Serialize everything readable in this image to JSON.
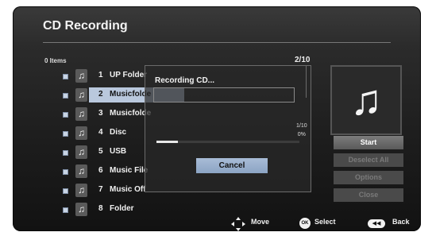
{
  "header": {
    "title": "CD Recording",
    "items_count": "0 Items",
    "page": "2/10"
  },
  "tracks": [
    {
      "num": "1",
      "name": "UP Folder",
      "selected": false
    },
    {
      "num": "2",
      "name": "Musicfolde",
      "selected": true
    },
    {
      "num": "3",
      "name": "Musicfolde",
      "selected": false
    },
    {
      "num": "4",
      "name": "Disc",
      "selected": false
    },
    {
      "num": "5",
      "name": "USB",
      "selected": false
    },
    {
      "num": "6",
      "name": "Music File",
      "selected": false
    },
    {
      "num": "7",
      "name": "Music Off",
      "selected": false
    },
    {
      "num": "8",
      "name": "Folder",
      "selected": false
    }
  ],
  "icons": {
    "track": "music-note-icon",
    "album_art": "music-note-icon"
  },
  "actions": [
    {
      "label": "Start",
      "enabled": true
    },
    {
      "label": "Deselect All",
      "enabled": false
    },
    {
      "label": "Options",
      "enabled": false
    },
    {
      "label": "Close",
      "enabled": false
    }
  ],
  "dialog": {
    "title": "Recording CD...",
    "progress_count": "1/10",
    "progress_percent": "0%",
    "progress_fraction": 0.15,
    "cancel_label": "Cancel"
  },
  "footer": {
    "move": "Move",
    "select": "Select",
    "back": "Back",
    "ok_glyph": "OK"
  },
  "colors": {
    "selection": "#b9c8dd",
    "button_active": "#6b6b6b",
    "cancel_button": "#9db2cf"
  }
}
